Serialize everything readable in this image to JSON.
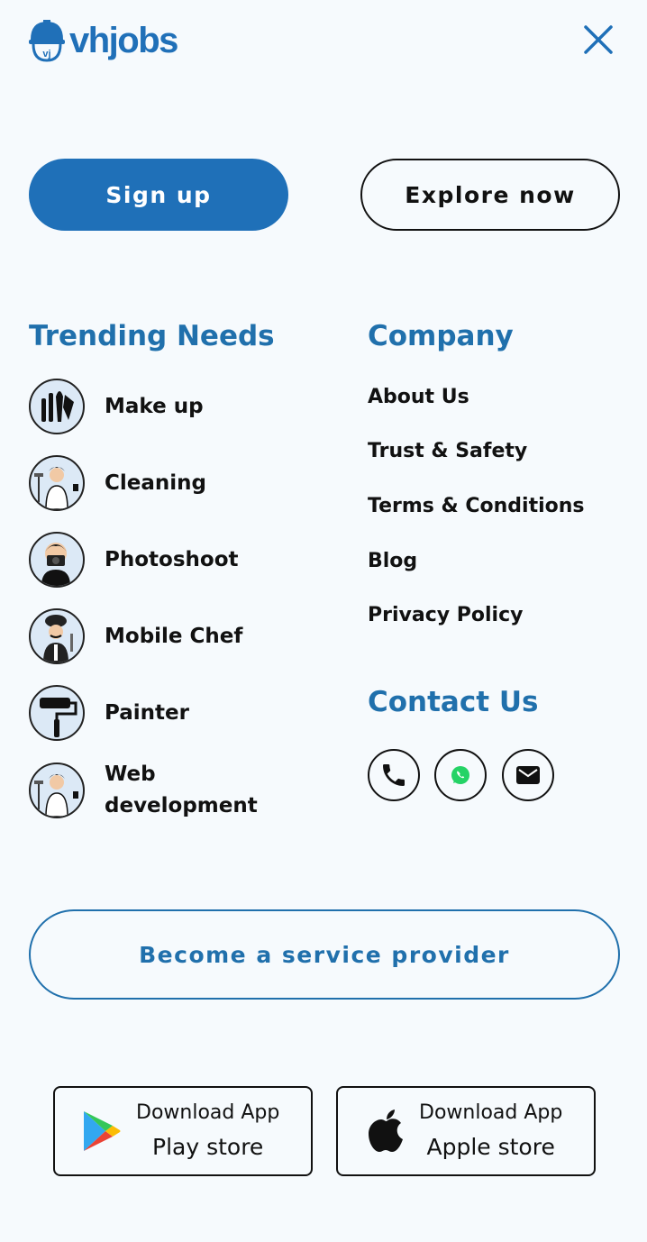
{
  "header": {
    "logo_text": "vhjobs",
    "brand_color": "#2070b8",
    "close_icon": "close-icon"
  },
  "actions": {
    "signup_label": "Sign up",
    "explore_label": "Explore now"
  },
  "trending": {
    "heading": "Trending Needs",
    "items": [
      {
        "label": "Make up",
        "icon": "makeup-brushes-icon"
      },
      {
        "label": "Cleaning",
        "icon": "cleaner-person-icon"
      },
      {
        "label": "Photoshoot",
        "icon": "photographer-icon"
      },
      {
        "label": "Mobile Chef",
        "icon": "chef-icon"
      },
      {
        "label": "Painter",
        "icon": "paint-roller-icon"
      },
      {
        "label": "Web development",
        "icon": "cleaner-person-icon"
      }
    ]
  },
  "company": {
    "heading": "Company",
    "links": [
      "About Us",
      "Trust & Safety",
      "Terms & Conditions",
      "Blog",
      "Privacy Policy"
    ]
  },
  "contact": {
    "heading": "Contact Us",
    "icons": [
      "phone-icon",
      "whatsapp-icon",
      "email-icon"
    ]
  },
  "provider": {
    "label": "Become a service provider"
  },
  "stores": {
    "play": {
      "line1": "Download App",
      "line2": "Play store"
    },
    "apple": {
      "line1": "Download App",
      "line2": "Apple store"
    }
  }
}
